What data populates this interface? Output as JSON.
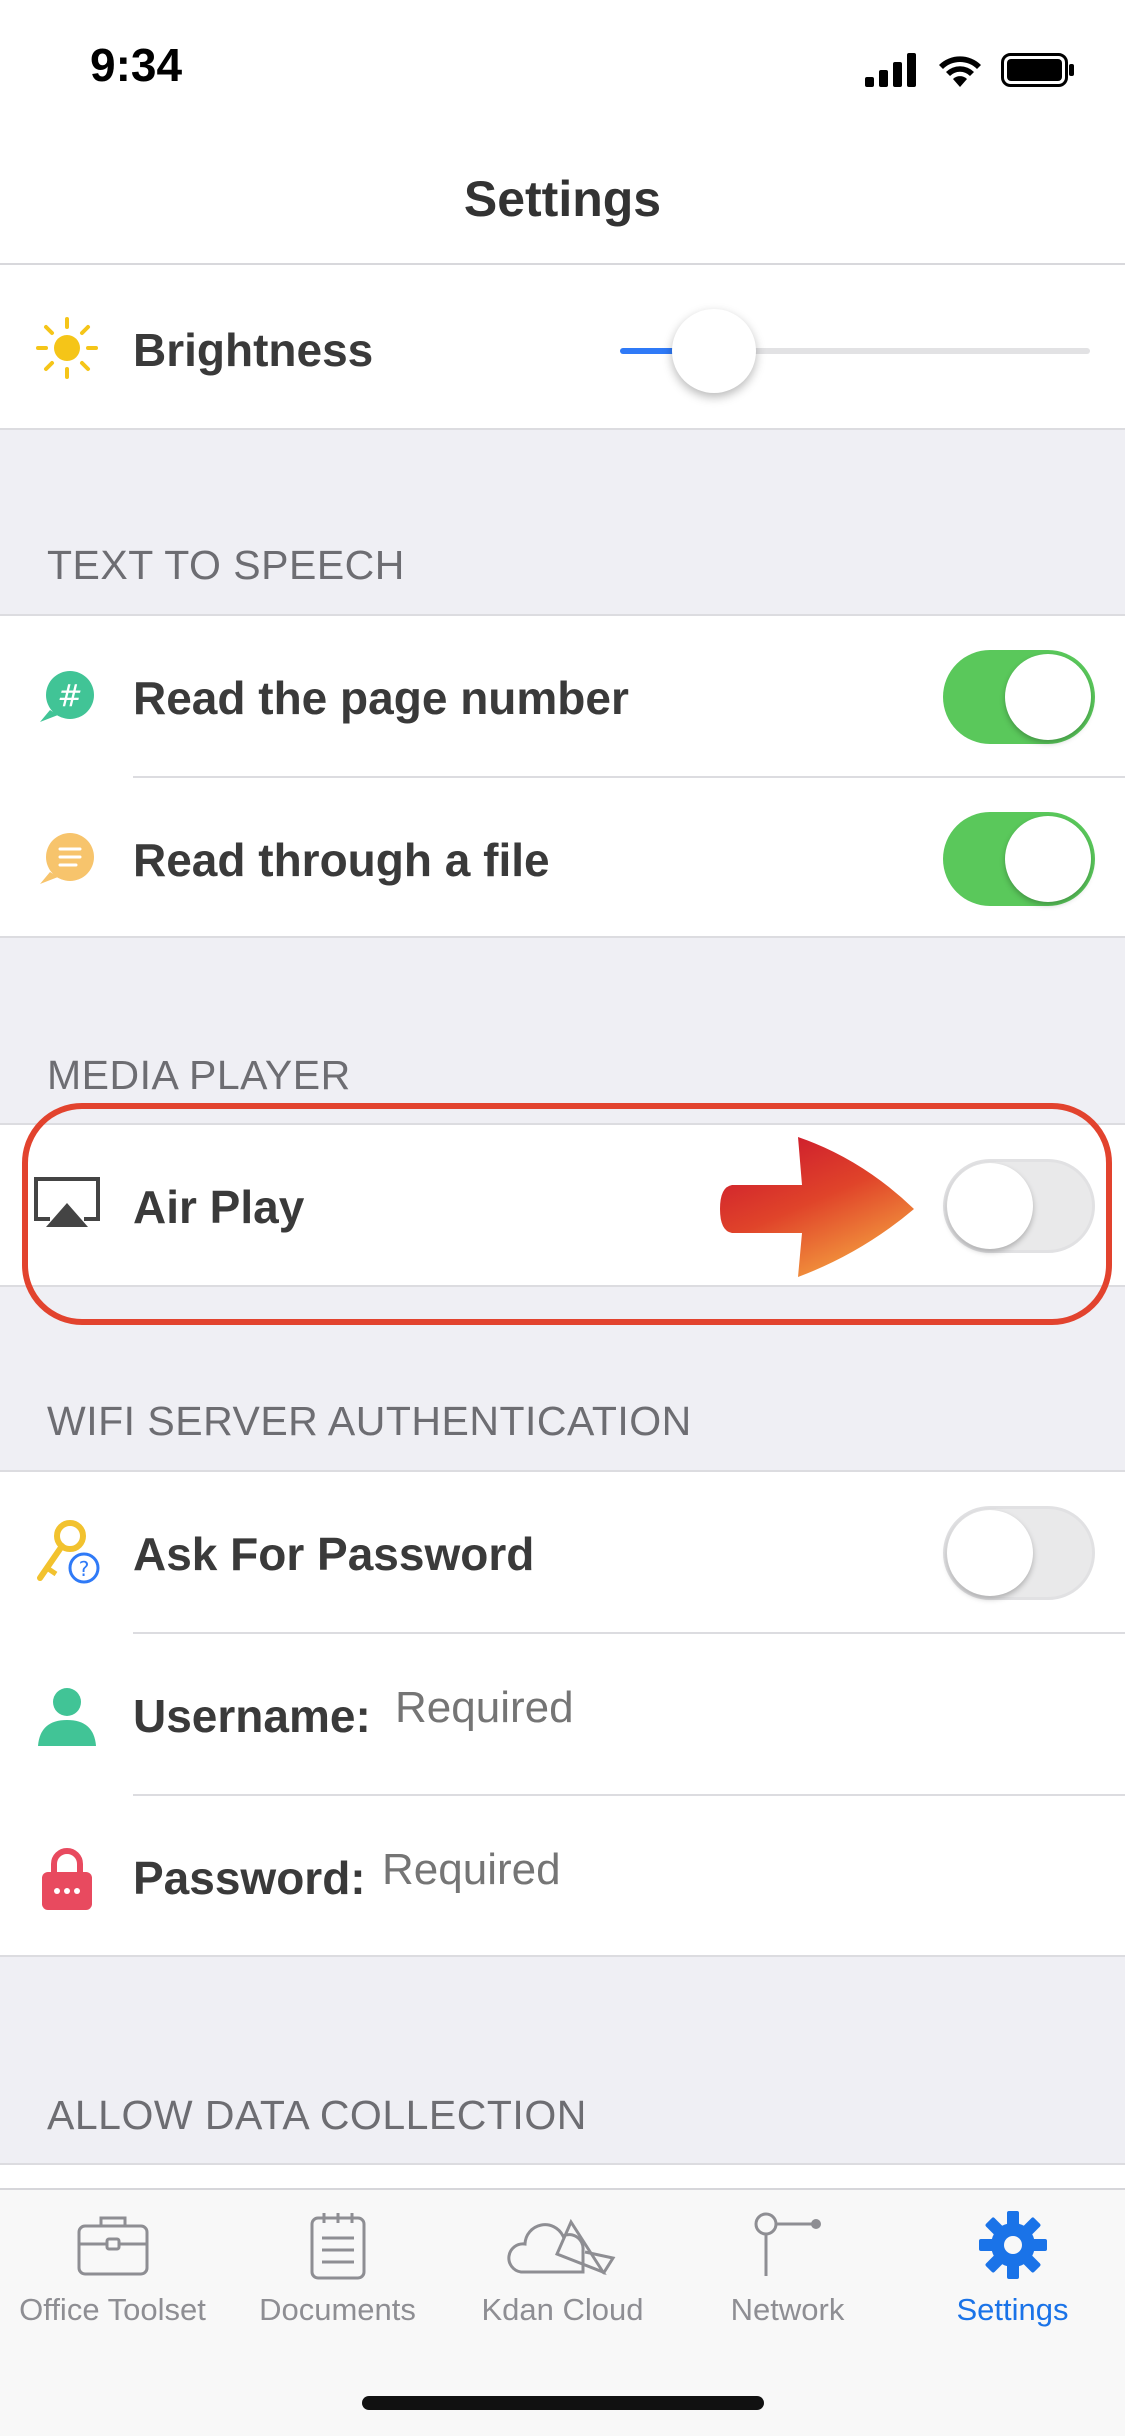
{
  "status_bar": {
    "time": "9:34"
  },
  "nav": {
    "title": "Settings"
  },
  "display": {
    "brightness_label": "Brightness",
    "brightness_level": 0.2
  },
  "text_to_speech": {
    "header": "TEXT TO SPEECH",
    "rows": [
      {
        "label": "Read the page number",
        "icon": "hash-bubble-icon",
        "on": true
      },
      {
        "label": "Read through a file",
        "icon": "lines-bubble-icon",
        "on": true
      }
    ]
  },
  "media_player": {
    "header": "MEDIA PLAYER",
    "airplay_label": "Air Play",
    "airplay_on": false
  },
  "wifi_auth": {
    "header": "WIFI SERVER AUTHENTICATION",
    "ask_password_label": "Ask For Password",
    "ask_password_on": false,
    "username_label": "Username:",
    "username_placeholder": "Required",
    "password_label": "Password:",
    "password_placeholder": "Required"
  },
  "data_collection": {
    "header": "ALLOW DATA COLLECTION"
  },
  "tabbar": {
    "tabs": [
      {
        "label": "Office Toolset",
        "icon": "briefcase-icon",
        "active": false
      },
      {
        "label": "Documents",
        "icon": "notepad-icon",
        "active": false
      },
      {
        "label": "Kdan Cloud",
        "icon": "cloud-icon",
        "active": false
      },
      {
        "label": "Network",
        "icon": "network-icon",
        "active": false
      },
      {
        "label": "Settings",
        "icon": "gear-icon",
        "active": true
      }
    ]
  },
  "colors": {
    "accent": "#1a73e8",
    "toggle_on": "#5ac85b",
    "highlight": "#e2432e",
    "slider_fill": "#2f7af7"
  }
}
